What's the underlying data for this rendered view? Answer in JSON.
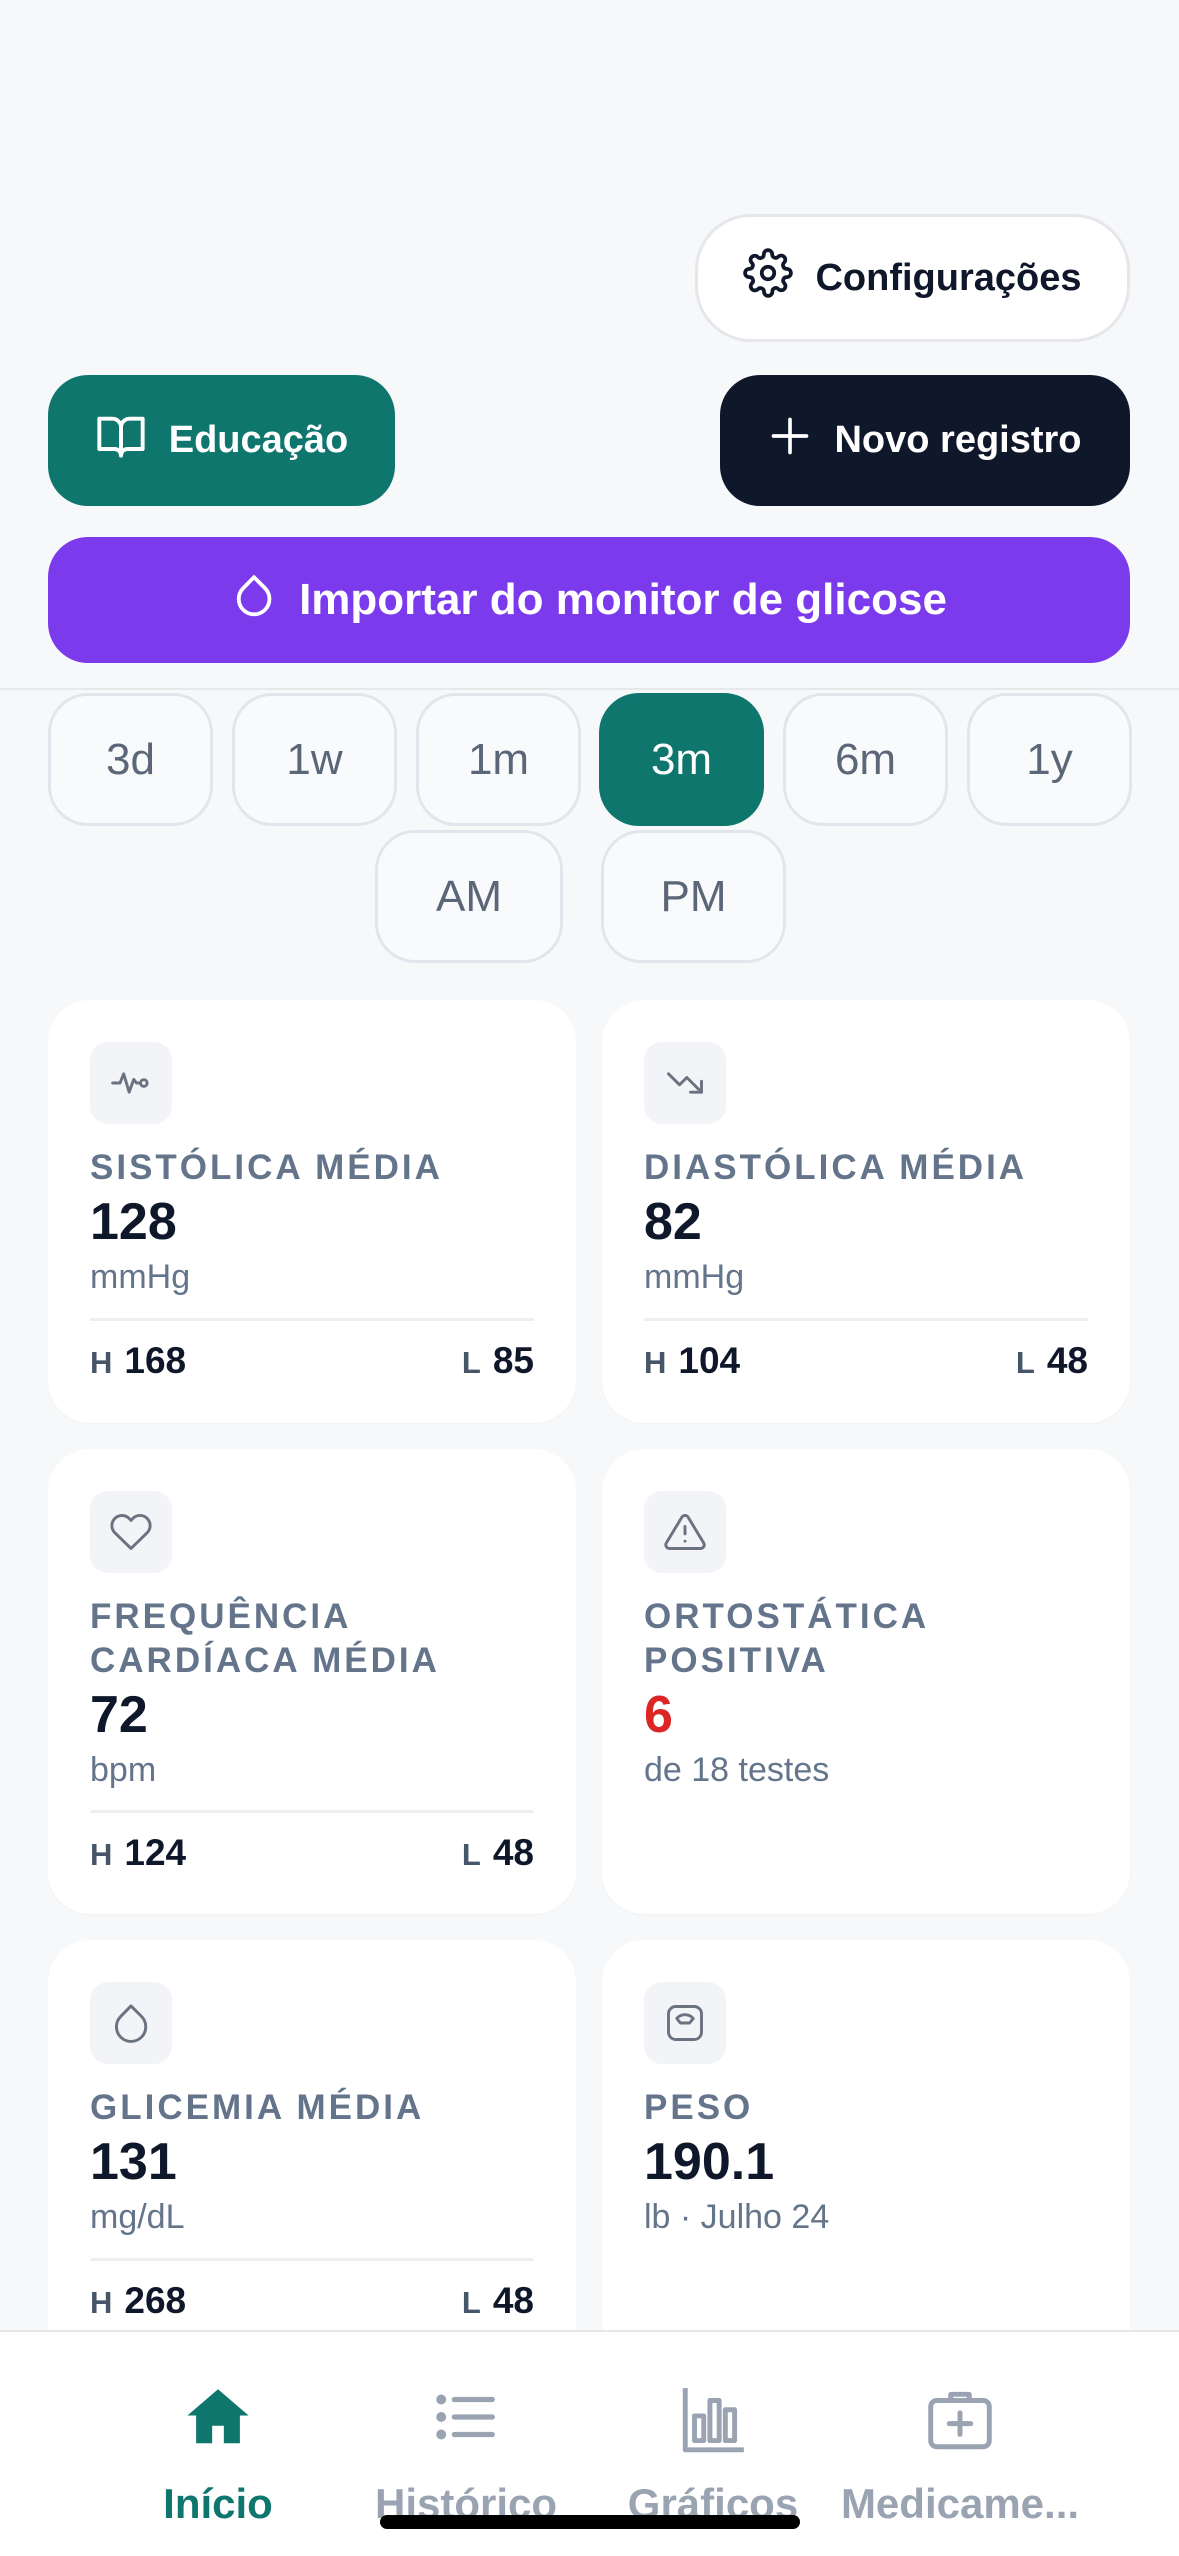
{
  "header": {
    "settings_label": "Configurações",
    "education_label": "Educação",
    "new_record_label": "Novo registro",
    "import_label": "Importar do monitor de glicose"
  },
  "ranges": {
    "options": [
      "3d",
      "1w",
      "1m",
      "3m",
      "6m",
      "1y"
    ],
    "selected": "3m",
    "period_options": [
      "AM",
      "PM"
    ]
  },
  "cards": {
    "systolic": {
      "icon": "activity-icon",
      "label": "SISTÓLICA MÉDIA",
      "value": "128",
      "unit": "mmHg",
      "high_key": "H",
      "high": "168",
      "low_key": "L",
      "low": "85"
    },
    "diastolic": {
      "icon": "trending-down-icon",
      "label": "DIASTÓLICA MÉDIA",
      "value": "82",
      "unit": "mmHg",
      "high_key": "H",
      "high": "104",
      "low_key": "L",
      "low": "48"
    },
    "heart_rate": {
      "icon": "heart-icon",
      "label": "FREQUÊNCIA CARDÍACA MÉDIA",
      "value": "72",
      "unit": "bpm",
      "high_key": "H",
      "high": "124",
      "low_key": "L",
      "low": "48"
    },
    "orthostatic": {
      "icon": "alert-triangle-icon",
      "label": "ORTOSTÁTICA POSITIVA",
      "value": "6",
      "value_color": "#dc2626",
      "detail": "de 18 testes"
    },
    "glucose": {
      "icon": "droplet-icon",
      "label": "GLICEMIA MÉDIA",
      "value": "131",
      "unit": "mg/dL",
      "high_key": "H",
      "high": "268",
      "low_key": "L",
      "low": "48"
    },
    "weight": {
      "icon": "scale-icon",
      "label": "PESO",
      "value": "190.1",
      "detail": "lb · Julho 24"
    }
  },
  "tabs": [
    {
      "label": "Início",
      "icon": "home-icon",
      "active": true
    },
    {
      "label": "Histórico",
      "icon": "list-icon",
      "active": false
    },
    {
      "label": "Gráficos",
      "icon": "bar-chart-icon",
      "active": false
    },
    {
      "label": "Medicame...",
      "icon": "medical-kit-icon",
      "active": false
    }
  ],
  "colors": {
    "accent": "#0f766e",
    "dark": "#0f172a",
    "purple": "#7c3aed",
    "alert": "#dc2626"
  }
}
